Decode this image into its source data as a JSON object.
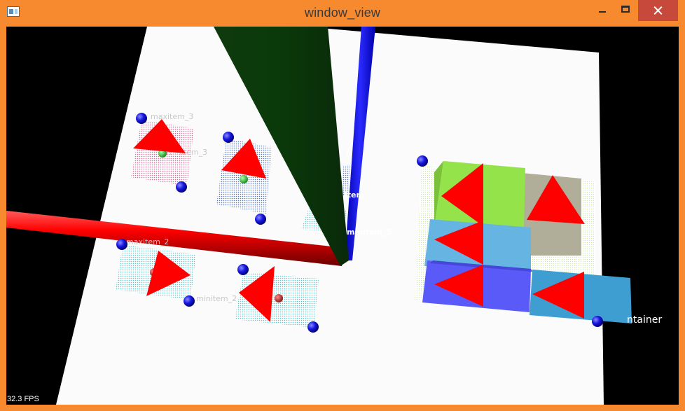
{
  "window": {
    "title": "window_view",
    "controls": [
      "minimize",
      "maximize",
      "close"
    ]
  },
  "viewport": {
    "fps": "32.3 FPS",
    "labels": [
      "maxitem_3",
      "minitem_3",
      "maxitem_2",
      "minitem_2",
      "5",
      "item",
      "minitem_5",
      "ntainer"
    ],
    "icons": {
      "app": "app-window-icon"
    }
  }
}
